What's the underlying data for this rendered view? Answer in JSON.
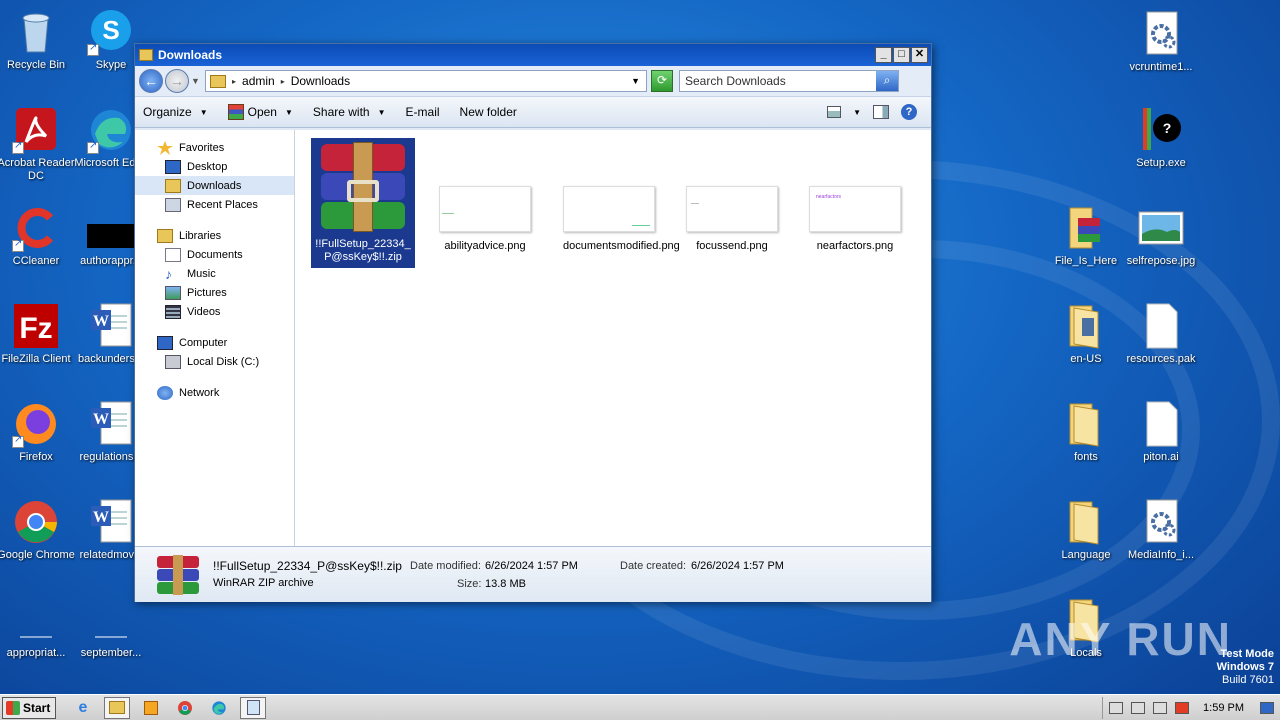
{
  "desktop": {
    "icons_left": [
      {
        "label": "Recycle Bin",
        "icon": "recycle-bin-icon"
      },
      {
        "label": "Skype",
        "icon": "skype-icon"
      },
      {
        "label": "Acrobat Reader DC",
        "icon": "acrobat-icon"
      },
      {
        "label": "Microsoft Edge",
        "icon": "edge-icon"
      },
      {
        "label": "CCleaner",
        "icon": "ccleaner-icon"
      },
      {
        "label": "authorappr...",
        "icon": "blank-file-icon"
      },
      {
        "label": "FileZilla Client",
        "icon": "filezilla-icon"
      },
      {
        "label": "backunders...",
        "icon": "word-doc-icon"
      },
      {
        "label": "Firefox",
        "icon": "firefox-icon"
      },
      {
        "label": "regulations...",
        "icon": "word-doc-icon"
      },
      {
        "label": "Google Chrome",
        "icon": "chrome-icon"
      },
      {
        "label": "relatedmov...",
        "icon": "word-doc-icon"
      },
      {
        "label": "appropriat...",
        "icon": "blank-file-icon"
      },
      {
        "label": "september...",
        "icon": "blank-file-icon"
      }
    ],
    "icons_right": [
      {
        "label": "vcruntime1...",
        "icon": "dll-settings-icon"
      },
      {
        "label": "Setup.exe",
        "icon": "setup-exe-icon"
      },
      {
        "label": "File_Is_Here",
        "icon": "winrar-folder-icon"
      },
      {
        "label": "selfrepose.jpg",
        "icon": "image-icon"
      },
      {
        "label": "en-US",
        "icon": "folder-icon"
      },
      {
        "label": "resources.pak",
        "icon": "blank-file-icon"
      },
      {
        "label": "fonts",
        "icon": "folder-icon"
      },
      {
        "label": "piton.ai",
        "icon": "blank-file-icon"
      },
      {
        "label": "Language",
        "icon": "folder-icon"
      },
      {
        "label": "MediaInfo_i...",
        "icon": "dll-settings-icon"
      },
      {
        "label": "Locals",
        "icon": "folder-icon"
      }
    ],
    "watermark": "ANY RUN",
    "test_mode": {
      "line1": "Test Mode",
      "line2": "Windows 7",
      "line3": "Build 7601"
    }
  },
  "window": {
    "title": "Downloads",
    "controls": {
      "minimize": "_",
      "maximize": "□",
      "close": "✕"
    },
    "address": {
      "crumbs": [
        "admin",
        "Downloads"
      ]
    },
    "search": {
      "placeholder": "Search Downloads"
    },
    "toolbar": {
      "organize": "Organize",
      "open": "Open",
      "share_with": "Share with",
      "email": "E-mail",
      "new_folder": "New folder"
    },
    "nav": {
      "favorites": "Favorites",
      "desktop": "Desktop",
      "downloads": "Downloads",
      "recent_places": "Recent Places",
      "libraries": "Libraries",
      "documents": "Documents",
      "music": "Music",
      "pictures": "Pictures",
      "videos": "Videos",
      "computer": "Computer",
      "local_disk": "Local Disk (C:)",
      "network": "Network"
    },
    "files": [
      {
        "name": "!!FullSetup_22334_P@ssKey$!!.zip",
        "type": "winrar-archive-icon",
        "selected": true
      },
      {
        "name": "abilityadvice.png",
        "type": "image-thumb"
      },
      {
        "name": "documentsmodified.png",
        "type": "image-thumb"
      },
      {
        "name": "focussend.png",
        "type": "image-thumb"
      },
      {
        "name": "nearfactors.png",
        "type": "image-thumb",
        "thumb_text": "nearfactors"
      }
    ],
    "details": {
      "name": "!!FullSetup_22334_P@ssKey$!!.zip",
      "type": "WinRAR ZIP archive",
      "modified_label": "Date modified:",
      "modified": "6/26/2024 1:57 PM",
      "created_label": "Date created:",
      "created": "6/26/2024 1:57 PM",
      "size_label": "Size:",
      "size": "13.8 MB"
    }
  },
  "taskbar": {
    "start": "Start",
    "time": "1:59 PM"
  }
}
